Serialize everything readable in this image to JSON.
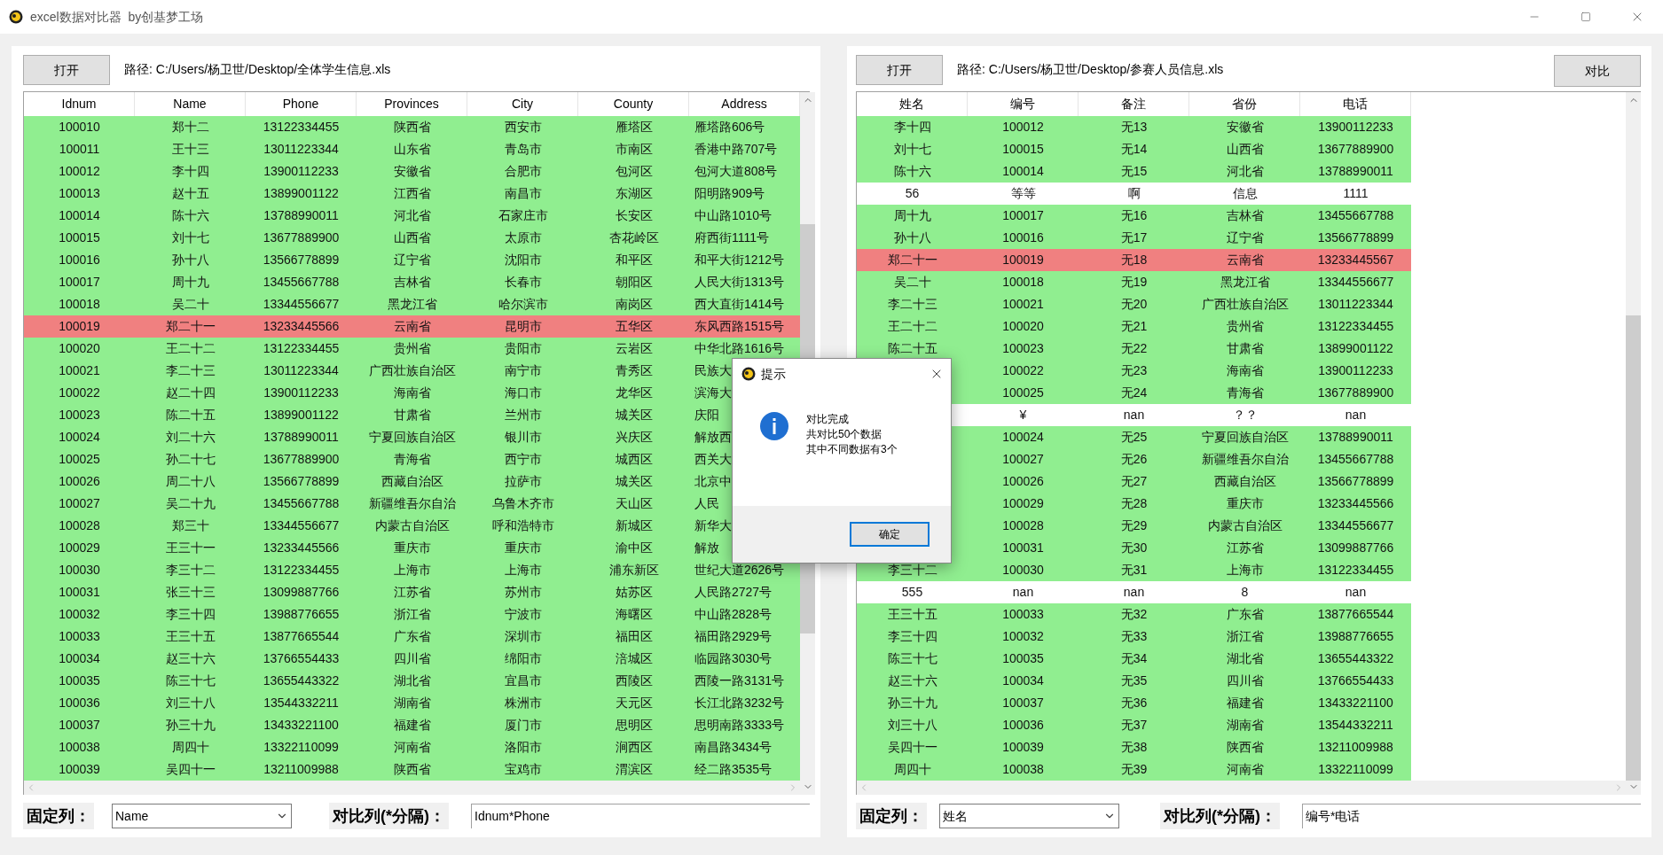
{
  "window": {
    "title": "excel数据对比器  by创基梦工场"
  },
  "panels": [
    {
      "open_button": "打开",
      "path": "路径: C:/Users/杨卫世/Desktop/全体学生信息.xls",
      "table": {
        "columns": [
          "Idnum",
          "Name",
          "Phone",
          "Provinces",
          "City",
          "County",
          "Address"
        ],
        "rows": [
          {
            "kind": "match",
            "cells": [
              "100010",
              "郑十二",
              "13122334455",
              "陕西省",
              "西安市",
              "雁塔区",
              "雁塔路606号"
            ]
          },
          {
            "kind": "match",
            "cells": [
              "100011",
              "王十三",
              "13011223344",
              "山东省",
              "青岛市",
              "市南区",
              "香港中路707号"
            ]
          },
          {
            "kind": "match",
            "cells": [
              "100012",
              "李十四",
              "13900112233",
              "安徽省",
              "合肥市",
              "包河区",
              "包河大道808号"
            ]
          },
          {
            "kind": "match",
            "cells": [
              "100013",
              "赵十五",
              "13899001122",
              "江西省",
              "南昌市",
              "东湖区",
              "阳明路909号"
            ]
          },
          {
            "kind": "match",
            "cells": [
              "100014",
              "陈十六",
              "13788990011",
              "河北省",
              "石家庄市",
              "长安区",
              "中山路1010号"
            ]
          },
          {
            "kind": "match",
            "cells": [
              "100015",
              "刘十七",
              "13677889900",
              "山西省",
              "太原市",
              "杏花岭区",
              "府西街1111号"
            ]
          },
          {
            "kind": "match",
            "cells": [
              "100016",
              "孙十八",
              "13566778899",
              "辽宁省",
              "沈阳市",
              "和平区",
              "和平大街1212号"
            ]
          },
          {
            "kind": "match",
            "cells": [
              "100017",
              "周十九",
              "13455667788",
              "吉林省",
              "长春市",
              "朝阳区",
              "人民大街1313号"
            ]
          },
          {
            "kind": "match",
            "cells": [
              "100018",
              "吴二十",
              "13344556677",
              "黑龙江省",
              "哈尔滨市",
              "南岗区",
              "西大直街1414号"
            ]
          },
          {
            "kind": "differ",
            "cells": [
              "100019",
              "郑二十一",
              "13233445566",
              "云南省",
              "昆明市",
              "五华区",
              "东风西路1515号"
            ]
          },
          {
            "kind": "match",
            "cells": [
              "100020",
              "王二十二",
              "13122334455",
              "贵州省",
              "贵阳市",
              "云岩区",
              "中华北路1616号"
            ]
          },
          {
            "kind": "match",
            "cells": [
              "100021",
              "李二十三",
              "13011223344",
              "广西壮族自治区",
              "南宁市",
              "青秀区",
              "民族大"
            ]
          },
          {
            "kind": "match",
            "cells": [
              "100022",
              "赵二十四",
              "13900112233",
              "海南省",
              "海口市",
              "龙华区",
              "滨海大"
            ]
          },
          {
            "kind": "match",
            "cells": [
              "100023",
              "陈二十五",
              "13899001122",
              "甘肃省",
              "兰州市",
              "城关区",
              "庆阳"
            ]
          },
          {
            "kind": "match",
            "cells": [
              "100024",
              "刘二十六",
              "13788990011",
              "宁夏回族自治区",
              "银川市",
              "兴庆区",
              "解放西"
            ]
          },
          {
            "kind": "match",
            "cells": [
              "100025",
              "孙二十七",
              "13677889900",
              "青海省",
              "西宁市",
              "城西区",
              "西关大"
            ]
          },
          {
            "kind": "match",
            "cells": [
              "100026",
              "周二十八",
              "13566778899",
              "西藏自治区",
              "拉萨市",
              "城关区",
              "北京中"
            ]
          },
          {
            "kind": "match",
            "cells": [
              "100027",
              "吴二十九",
              "13455667788",
              "新疆维吾尔自治",
              "乌鲁木齐市",
              "天山区",
              "人民"
            ]
          },
          {
            "kind": "match",
            "cells": [
              "100028",
              "郑三十",
              "13344556677",
              "内蒙古自治区",
              "呼和浩特市",
              "新城区",
              "新华大"
            ]
          },
          {
            "kind": "match",
            "cells": [
              "100029",
              "王三十一",
              "13233445566",
              "重庆市",
              "重庆市",
              "渝中区",
              "解放"
            ]
          },
          {
            "kind": "match",
            "cells": [
              "100030",
              "李三十二",
              "13122334455",
              "上海市",
              "上海市",
              "浦东新区",
              "世纪大道2626号"
            ]
          },
          {
            "kind": "match",
            "cells": [
              "100031",
              "张三十三",
              "13099887766",
              "江苏省",
              "苏州市",
              "姑苏区",
              "人民路2727号"
            ]
          },
          {
            "kind": "match",
            "cells": [
              "100032",
              "李三十四",
              "13988776655",
              "浙江省",
              "宁波市",
              "海曙区",
              "中山路2828号"
            ]
          },
          {
            "kind": "match",
            "cells": [
              "100033",
              "王三十五",
              "13877665544",
              "广东省",
              "深圳市",
              "福田区",
              "福田路2929号"
            ]
          },
          {
            "kind": "match",
            "cells": [
              "100034",
              "赵三十六",
              "13766554433",
              "四川省",
              "绵阳市",
              "涪城区",
              "临园路3030号"
            ]
          },
          {
            "kind": "match",
            "cells": [
              "100035",
              "陈三十七",
              "13655443322",
              "湖北省",
              "宜昌市",
              "西陵区",
              "西陵一路3131号"
            ]
          },
          {
            "kind": "match",
            "cells": [
              "100036",
              "刘三十八",
              "13544332211",
              "湖南省",
              "株洲市",
              "天元区",
              "长江北路3232号"
            ]
          },
          {
            "kind": "match",
            "cells": [
              "100037",
              "孙三十九",
              "13433221100",
              "福建省",
              "厦门市",
              "思明区",
              "思明南路3333号"
            ]
          },
          {
            "kind": "match",
            "cells": [
              "100038",
              "周四十",
              "13322110099",
              "河南省",
              "洛阳市",
              "涧西区",
              "南昌路3434号"
            ]
          },
          {
            "kind": "match",
            "cells": [
              "100039",
              "吴四十一",
              "13211009988",
              "陕西省",
              "宝鸡市",
              "渭滨区",
              "经二路3535号"
            ]
          }
        ]
      },
      "fixed_label": "固定列：",
      "fixed_value": "Name",
      "compare_label": "对比列(*分隔)：",
      "compare_value": "Idnum*Phone"
    },
    {
      "open_button": "打开",
      "path": "路径: C:/Users/杨卫世/Desktop/参赛人员信息.xls",
      "compare_button": "对比",
      "table": {
        "columns": [
          "姓名",
          "编号",
          "备注",
          "省份",
          "电话"
        ],
        "rows": [
          {
            "kind": "match",
            "cells": [
              "李十四",
              "100012",
              "无13",
              "安徽省",
              "13900112233"
            ]
          },
          {
            "kind": "match",
            "cells": [
              "刘十七",
              "100015",
              "无14",
              "山西省",
              "13677889900"
            ]
          },
          {
            "kind": "match",
            "cells": [
              "陈十六",
              "100014",
              "无15",
              "河北省",
              "13788990011"
            ]
          },
          {
            "kind": "unmatched",
            "cells": [
              "56",
              "等等",
              "啊",
              "信息",
              "1111"
            ]
          },
          {
            "kind": "match",
            "cells": [
              "周十九",
              "100017",
              "无16",
              "吉林省",
              "13455667788"
            ]
          },
          {
            "kind": "match",
            "cells": [
              "孙十八",
              "100016",
              "无17",
              "辽宁省",
              "13566778899"
            ]
          },
          {
            "kind": "differ",
            "cells": [
              "郑二十一",
              "100019",
              "无18",
              "云南省",
              "13233445567"
            ]
          },
          {
            "kind": "match",
            "cells": [
              "吴二十",
              "100018",
              "无19",
              "黑龙江省",
              "13344556677"
            ]
          },
          {
            "kind": "match",
            "cells": [
              "李二十三",
              "100021",
              "无20",
              "广西壮族自治区",
              "13011223344"
            ]
          },
          {
            "kind": "match",
            "cells": [
              "王二十二",
              "100020",
              "无21",
              "贵州省",
              "13122334455"
            ]
          },
          {
            "kind": "match",
            "cells": [
              "陈二十五",
              "100023",
              "无22",
              "甘肃省",
              "13899001122"
            ]
          },
          {
            "kind": "match",
            "cells": [
              null,
              "100022",
              "无23",
              "海南省",
              "13900112233"
            ]
          },
          {
            "kind": "match",
            "cells": [
              null,
              "100025",
              "无24",
              "青海省",
              "13677889900"
            ]
          },
          {
            "kind": "unmatched",
            "cells": [
              null,
              "¥",
              "nan",
              "？？",
              "nan"
            ]
          },
          {
            "kind": "match",
            "cells": [
              null,
              "100024",
              "无25",
              "宁夏回族自治区",
              "13788990011"
            ]
          },
          {
            "kind": "match",
            "cells": [
              null,
              "100027",
              "无26",
              "新疆维吾尔自治",
              "13455667788"
            ]
          },
          {
            "kind": "match",
            "cells": [
              null,
              "100026",
              "无27",
              "西藏自治区",
              "13566778899"
            ]
          },
          {
            "kind": "match",
            "cells": [
              null,
              "100029",
              "无28",
              "重庆市",
              "13233445566"
            ]
          },
          {
            "kind": "match",
            "cells": [
              null,
              "100028",
              "无29",
              "内蒙古自治区",
              "13344556677"
            ]
          },
          {
            "kind": "match",
            "cells": [
              null,
              "100031",
              "无30",
              "江苏省",
              "13099887766"
            ]
          },
          {
            "kind": "match",
            "cells": [
              "李三十二",
              "100030",
              "无31",
              "上海市",
              "13122334455"
            ]
          },
          {
            "kind": "unmatched",
            "cells": [
              "555",
              "nan",
              "nan",
              "8",
              "nan"
            ]
          },
          {
            "kind": "match",
            "cells": [
              "王三十五",
              "100033",
              "无32",
              "广东省",
              "13877665544"
            ]
          },
          {
            "kind": "match",
            "cells": [
              "李三十四",
              "100032",
              "无33",
              "浙江省",
              "13988776655"
            ]
          },
          {
            "kind": "match",
            "cells": [
              "陈三十七",
              "100035",
              "无34",
              "湖北省",
              "13655443322"
            ]
          },
          {
            "kind": "match",
            "cells": [
              "赵三十六",
              "100034",
              "无35",
              "四川省",
              "13766554433"
            ]
          },
          {
            "kind": "match",
            "cells": [
              "孙三十九",
              "100037",
              "无36",
              "福建省",
              "13433221100"
            ]
          },
          {
            "kind": "match",
            "cells": [
              "刘三十八",
              "100036",
              "无37",
              "湖南省",
              "13544332211"
            ]
          },
          {
            "kind": "match",
            "cells": [
              "吴四十一",
              "100039",
              "无38",
              "陕西省",
              "13211009988"
            ]
          },
          {
            "kind": "match",
            "cells": [
              "周四十",
              "100038",
              "无39",
              "河南省",
              "13322110099"
            ]
          }
        ]
      },
      "fixed_label": "固定列：",
      "fixed_value": "姓名",
      "compare_label": "对比列(*分隔)：",
      "compare_value": "编号*电话"
    }
  ],
  "dialog": {
    "title": "提示",
    "lines": [
      "对比完成",
      "共对比50个数据",
      "其中不同数据有3个"
    ],
    "button": "确定"
  }
}
